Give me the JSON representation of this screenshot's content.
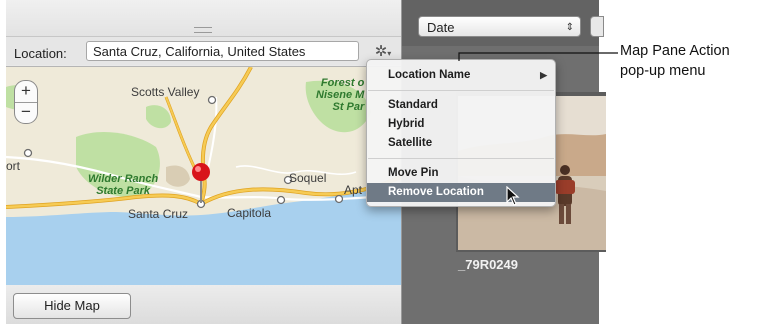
{
  "location": {
    "label": "Location:",
    "value": "Santa Cruz, California, United States"
  },
  "gear_icon": "gear-icon",
  "map": {
    "zoom_in": "+",
    "zoom_out": "−",
    "labels": {
      "scotts_valley": "Scotts Valley",
      "forest_nisene": [
        "Forest o",
        "Nisene M",
        "St Par"
      ],
      "wilder_ranch": [
        "Wilder Ranch",
        "State Park"
      ],
      "santa_cruz": "Santa Cruz",
      "capitola": "Capitola",
      "soquel": "Soquel",
      "aptos": "Apt",
      "port": "ort"
    },
    "colors": {
      "land": "#efead9",
      "water": "#a8d0ee",
      "park": "#bfe0a3",
      "road": "#f4c34a"
    }
  },
  "hide_map_button": "Hide Map",
  "browser": {
    "sort_value": "Date",
    "sort_arrows": "⇕",
    "photo_caption": "_79R0249"
  },
  "menu": {
    "items": [
      {
        "label": "Location Name",
        "submenu_arrow": "▶"
      },
      {
        "label": "Standard"
      },
      {
        "label": "Hybrid"
      },
      {
        "label": "Satellite"
      },
      {
        "label": "Move Pin"
      },
      {
        "label": "Remove Location",
        "highlighted": true
      }
    ]
  },
  "callout": {
    "line1": "Map Pane Action",
    "line2": "pop-up menu"
  }
}
